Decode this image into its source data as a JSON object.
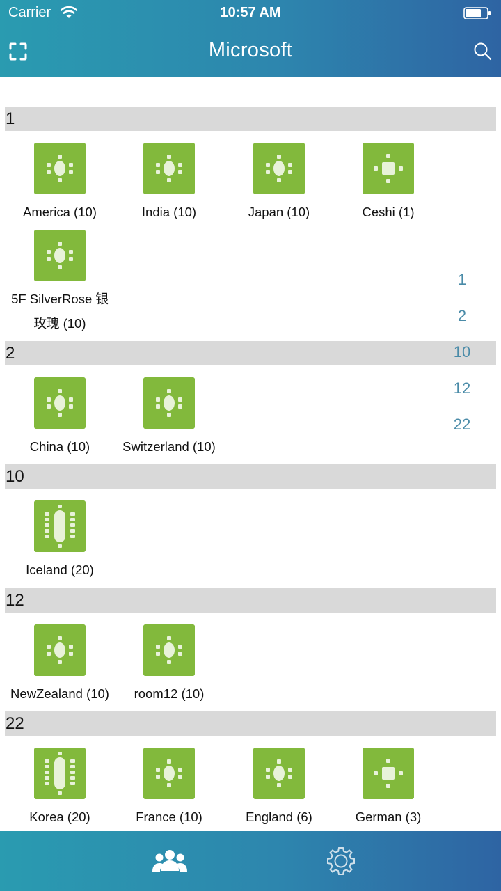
{
  "status_bar": {
    "carrier": "Carrier",
    "time": "10:57 AM"
  },
  "header": {
    "title": "Microsoft"
  },
  "sections": [
    {
      "label": "1",
      "rooms": [
        {
          "name": "America (10)",
          "icon": "meeting-table-small-icon"
        },
        {
          "name": "India (10)",
          "icon": "meeting-table-small-icon"
        },
        {
          "name": "Japan (10)",
          "icon": "meeting-table-small-icon"
        },
        {
          "name": "Ceshi (1)",
          "icon": "meeting-table-tiny-icon"
        },
        {
          "name_line1": "5F SilverRose 银",
          "name_line2": "玫瑰 (10)",
          "icon": "meeting-table-small-icon"
        }
      ]
    },
    {
      "label": "2",
      "rooms": [
        {
          "name": "China (10)",
          "icon": "meeting-table-small-icon"
        },
        {
          "name": "Switzerland (10)",
          "icon": "meeting-table-small-icon"
        }
      ]
    },
    {
      "label": "10",
      "rooms": [
        {
          "name": "Iceland (20)",
          "icon": "meeting-table-large-icon"
        }
      ]
    },
    {
      "label": "12",
      "rooms": [
        {
          "name": "NewZealand (10)",
          "icon": "meeting-table-small-icon"
        },
        {
          "name": "room12 (10)",
          "icon": "meeting-table-small-icon"
        }
      ]
    },
    {
      "label": "22",
      "rooms": [
        {
          "name": "Korea (20)",
          "icon": "meeting-table-large-icon"
        },
        {
          "name": "France (10)",
          "icon": "meeting-table-small-icon"
        },
        {
          "name": "England (6)",
          "icon": "meeting-table-small-icon"
        },
        {
          "name": "German (3)",
          "icon": "meeting-table-tiny-icon"
        }
      ]
    }
  ],
  "index": [
    "1",
    "2",
    "10",
    "12",
    "22"
  ],
  "tabbar": {
    "tabs": [
      {
        "icon": "people-icon",
        "active": true
      },
      {
        "icon": "gear-icon",
        "active": false
      }
    ]
  },
  "colors": {
    "header_gradient_start": "#2a9bb0",
    "header_gradient_end": "#2e64a3",
    "room_icon": "#82b93c",
    "section_bg": "#d9d9d9",
    "index_text": "#4a8ba8"
  }
}
